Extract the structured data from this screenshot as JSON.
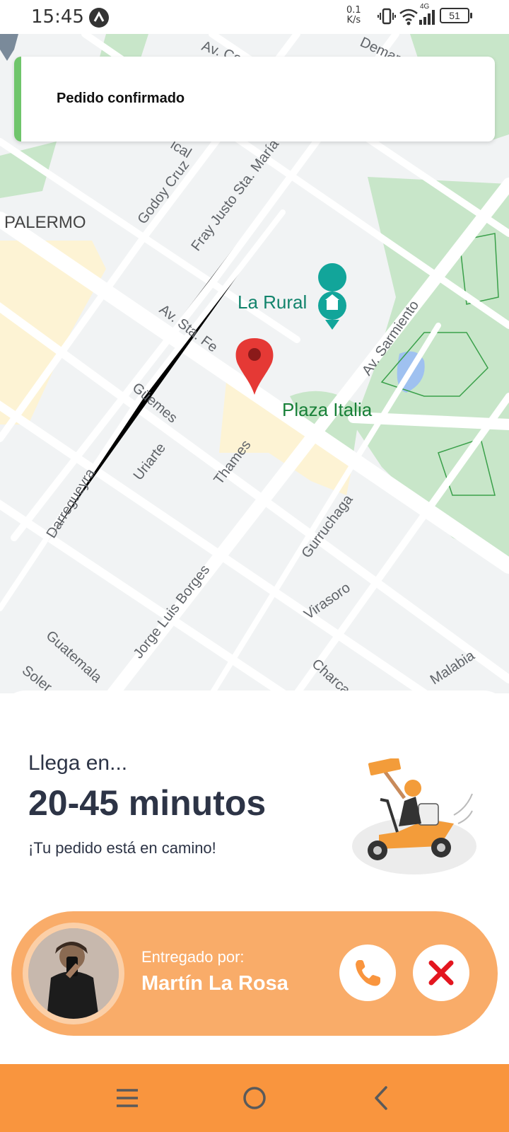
{
  "status_bar": {
    "time": "15:45",
    "net_speed_value": "0.1",
    "net_speed_unit": "K/s",
    "network_type": "4G",
    "battery": "51"
  },
  "map": {
    "area_labels": [
      "PALERMO"
    ],
    "poi_labels": [
      "La Rural",
      "Plaza Italia"
    ],
    "street_labels": [
      "Godoy Cruz",
      "Fray Justo Sta. María",
      "Av. Sta. Fe",
      "Av. Sarmiento",
      "Güemes",
      "Uriarte",
      "Thames",
      "Darregueyra",
      "Gurruchaga",
      "Jorge Luis Borges",
      "Virasoro",
      "Guatemala",
      "Charcas",
      "Malabia",
      "Av. Co",
      "Demar",
      "Soler",
      "ical"
    ]
  },
  "toast": {
    "message": "Pedido confirmado",
    "accent_color": "#6fc56b"
  },
  "delivery": {
    "arrive_label": "Llega en...",
    "arrive_value": "20-45 minutos",
    "status_note": "¡Tu pedido está en camino!"
  },
  "driver": {
    "label": "Entregado por:",
    "name": "Martín La Rosa"
  },
  "colors": {
    "accent": "#f9953e",
    "card": "#f9ac69",
    "cancel": "#e3161f",
    "text_dark": "#2d3446"
  },
  "icons": {
    "call": "phone-icon",
    "cancel": "close-icon",
    "nav_menu": "menu-icon",
    "nav_home": "home-icon",
    "nav_back": "back-icon"
  }
}
